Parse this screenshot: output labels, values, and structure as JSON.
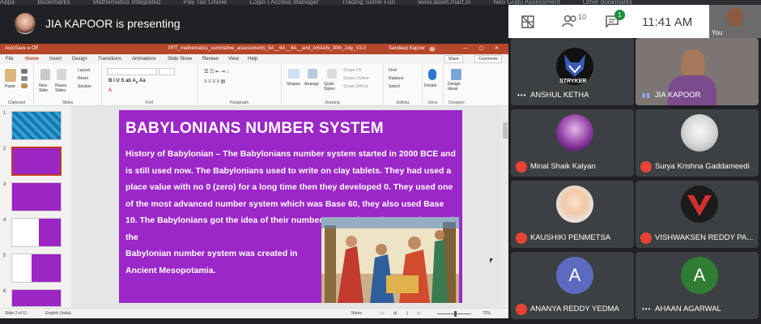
{
  "bookmarks": [
    "Apps",
    "Bookmarks",
    "Mathematics Integrated",
    "Pay Tax Online",
    "Login | Access Manager",
    "Trading Some Fun",
    "www.asset.mart.in",
    "Neo Gratu Assessment",
    "Other bookmarks"
  ],
  "presenter": {
    "text": "JIA KAPOOR is presenting"
  },
  "powerpoint": {
    "autosave": "AutoSave ● Off",
    "doc_title": "PPT_mathematics_summative_assessments_5A__6A__6A__and_AHAAN_30th_July_V3.0",
    "user": "Sandeep Kapoor",
    "user_initials": "SK",
    "tabs": [
      "File",
      "Home",
      "Insert",
      "Design",
      "Transitions",
      "Animations",
      "Slide Show",
      "Review",
      "View",
      "Help"
    ],
    "active_tab": "Home",
    "share": "Share",
    "comments": "Comments",
    "ribbon": {
      "paste": "Paste",
      "new_slide": "New Slide",
      "reuse_slides": "Reuse Slides",
      "layout": "Layout",
      "reset": "Reset",
      "section": "Section",
      "shapes": "Shapes",
      "arrange": "Arrange",
      "quick_styles": "Quick Styles",
      "shape_fill": "Shape Fill",
      "shape_outline": "Shape Outline",
      "shape_effects": "Shape Effects",
      "find": "Find",
      "replace": "Replace",
      "select": "Select",
      "dictate": "Dictate",
      "design_ideas": "Design Ideas",
      "groups": [
        "Clipboard",
        "Slides",
        "Font",
        "Paragraph",
        "Drawing",
        "Editing",
        "Voice",
        "Designer"
      ]
    },
    "thumb_numbers": [
      "1",
      "2",
      "3",
      "4",
      "5",
      "6"
    ],
    "slide": {
      "title": "BABYLONIANS NUMBER SYSTEM",
      "body": "History of Babylonian – The Babylonians number system started in 2000 BCE and is still used now. The Babylonians used to write on clay tablets. They had used a place value with no 0 (zero) for a long time then they developed 0. They used one of the most advanced number system which was Base 60, they also used Base 10. The Babylonians got the idea of their number system from the Sumerians and the",
      "body2": "Babylonian number system was created in Ancient Mesopotamia."
    },
    "status": {
      "slide": "Slide 2 of 11",
      "language": "English (India)",
      "notes": "Notes",
      "zoom": "72%"
    }
  },
  "meet": {
    "notif_count": "1",
    "people_count": "10",
    "time": "11:41 AM",
    "you": "You",
    "participants": [
      {
        "name": "ANSHUL KETHA",
        "logo": "STRYKER"
      },
      {
        "name": "JIA KAPOOR"
      },
      {
        "name": "Minal Shaik Kalyan"
      },
      {
        "name": "Surya Krishna Gaddameedi"
      },
      {
        "name": "KAUSHIKI PENMETSA"
      },
      {
        "name": "VISHWAKSEN REDDY PA..."
      },
      {
        "name": "ANANYA REDDY YEDMA",
        "initial": "A"
      },
      {
        "name": "AHAAN AGARWAL",
        "initial": "A"
      }
    ],
    "colors": {
      "mute": "#ea4335",
      "avatar_ananya": "#5c6bc0",
      "avatar_ahaan": "#2e7d32"
    }
  }
}
